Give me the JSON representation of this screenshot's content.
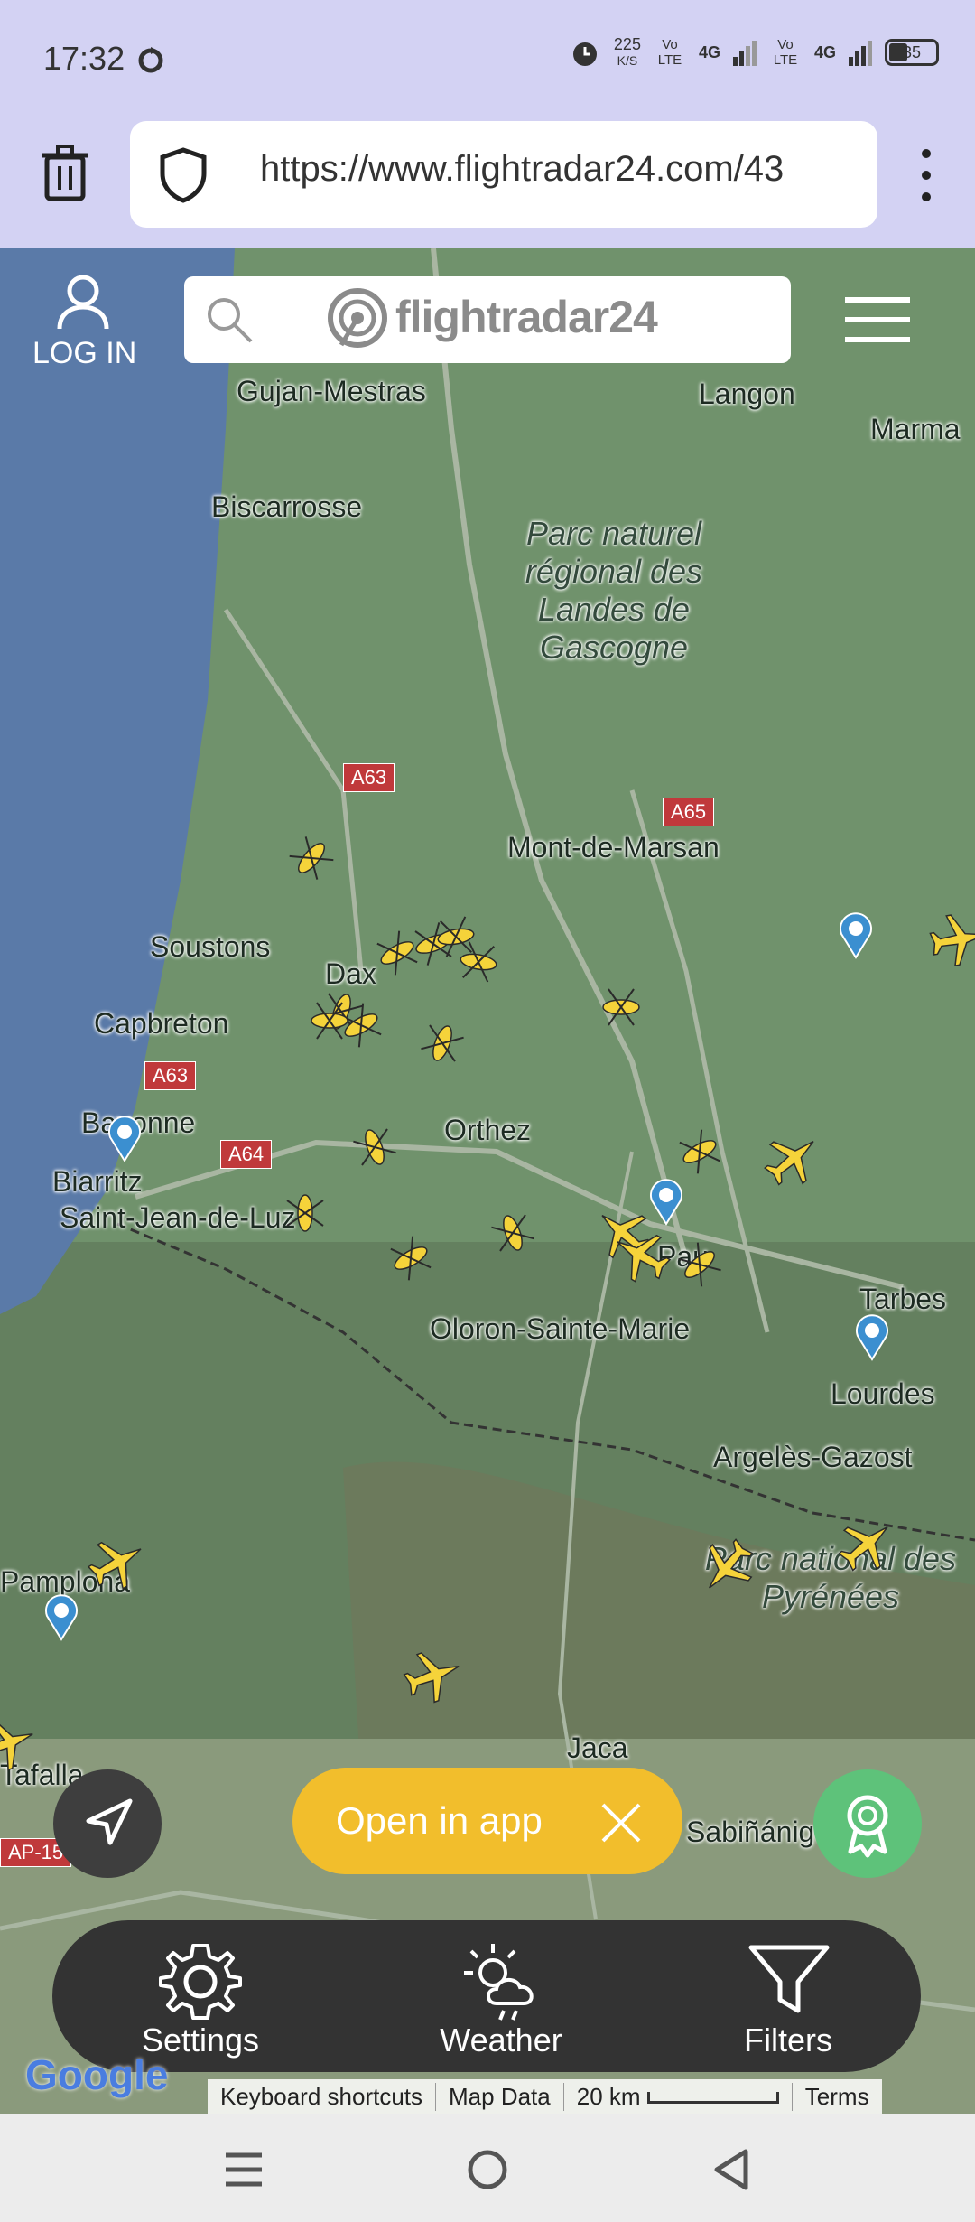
{
  "status_bar": {
    "time": "17:32",
    "net_speed": "225",
    "net_speed_unit": "K/S",
    "sim1": "Vo LTE",
    "sim1_net": "4G",
    "sim2": "Vo LTE",
    "sim2_net": "4G",
    "battery": "35"
  },
  "browser": {
    "url": "https://www.flightradar24.com/43"
  },
  "header": {
    "login_label": "LOG IN",
    "logo_text": "flightradar24"
  },
  "map": {
    "labels": {
      "gujan": "Gujan-Mestras",
      "langon": "Langon",
      "marmande": "Marma",
      "biscarrosse": "Biscarrosse",
      "park1": "Parc naturel régional des Landes de Gascogne",
      "montdemarsan": "Mont-de-Marsan",
      "soustons": "Soustons",
      "dax": "Dax",
      "capbreton": "Capbreton",
      "bayonne": "Bayonne",
      "biarritz": "Biarritz",
      "stjean": "Saint-Jean-de-Luz",
      "orthez": "Orthez",
      "pau": "Pau",
      "tarbes": "Tarbes",
      "oloron": "Oloron-Sainte-Marie",
      "lourdes": "Lourdes",
      "argeles": "Argelès-Gazost",
      "park2": "Parc national des Pyrénées",
      "pamplona": "Pamplona",
      "tafalla": "Tafalla",
      "jaca": "Jaca",
      "sabinanigo": "Sabiñánigo"
    },
    "roads": {
      "a63a": "A63",
      "a65": "A65",
      "a63b": "A63",
      "a64": "A64",
      "ap15": "AP-15"
    }
  },
  "controls": {
    "open_in_app": "Open in app",
    "settings": "Settings",
    "weather": "Weather",
    "filters": "Filters"
  },
  "attribution": {
    "google": "Google",
    "shortcuts": "Keyboard shortcuts",
    "map_data": "Map Data",
    "scale": "20 km",
    "terms": "Terms"
  }
}
